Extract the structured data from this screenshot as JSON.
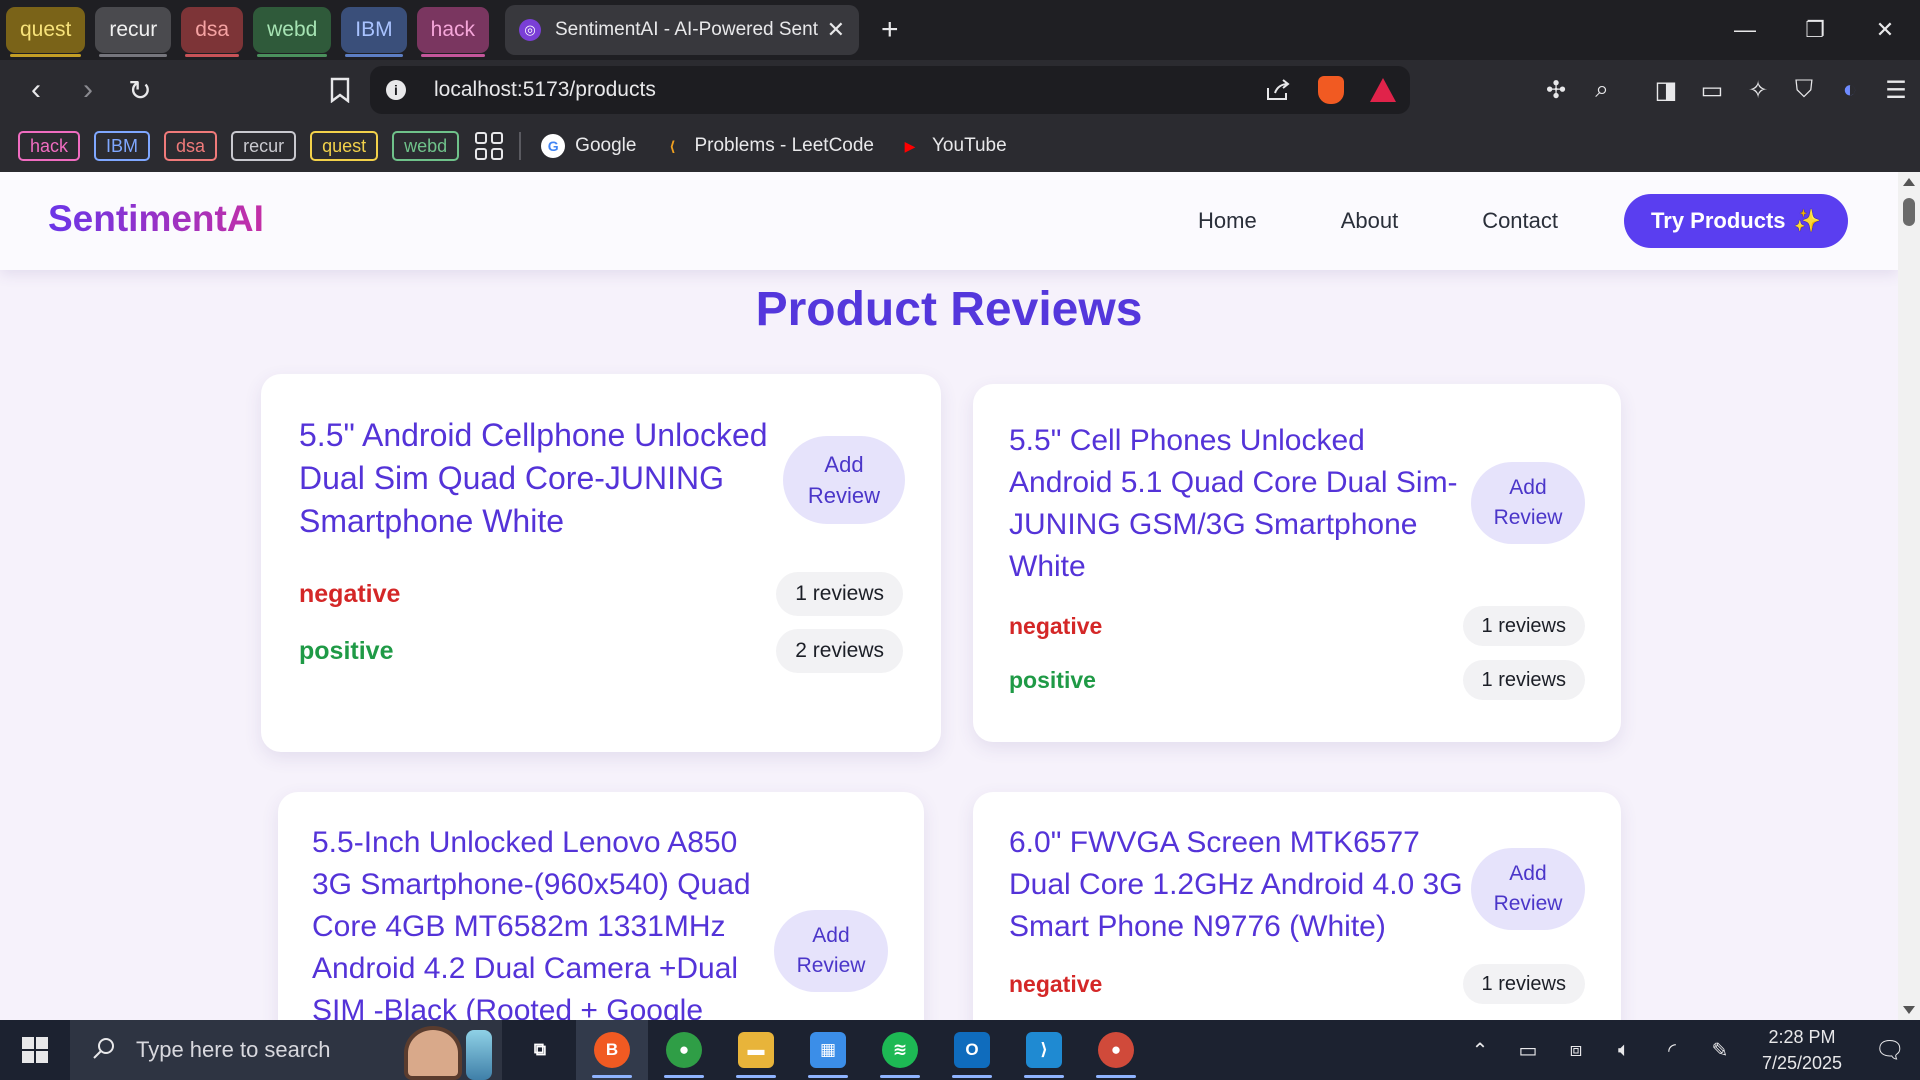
{
  "browser": {
    "tab_groups": [
      {
        "label": "quest",
        "bg": "#7a6318",
        "fg": "#f7e27a"
      },
      {
        "label": "recur",
        "bg": "#4a4a4e",
        "fg": "#f0f0f0"
      },
      {
        "label": "dsa",
        "bg": "#7d3437",
        "fg": "#f5a3a3"
      },
      {
        "label": "webd",
        "bg": "#2f5a3a",
        "fg": "#a6e3b3"
      },
      {
        "label": "IBM",
        "bg": "#3a4f7a",
        "fg": "#a9c3ff"
      },
      {
        "label": "hack",
        "bg": "#7a3660",
        "fg": "#f5a6d9"
      }
    ],
    "active_tab": {
      "title": "SentimentAI - AI-Powered Sentiment",
      "close": "✕"
    },
    "new_tab": "+",
    "window_controls": {
      "minimize": "—",
      "restore": "❐",
      "close": "✕"
    },
    "address": {
      "url": "localhost:5173/products"
    },
    "nav": {
      "back": "‹",
      "forward": "›",
      "reload": "↻"
    },
    "bookmarks_chips": [
      {
        "label": "hack",
        "color": "#f06cc0"
      },
      {
        "label": "IBM",
        "color": "#7fa7ff"
      },
      {
        "label": "dsa",
        "color": "#f07a7a"
      },
      {
        "label": "recur",
        "color": "#c9c9cf"
      },
      {
        "label": "quest",
        "color": "#f2d14a"
      },
      {
        "label": "webd",
        "color": "#6fc28a"
      }
    ],
    "bookmarks_links": [
      {
        "label": "Google",
        "icon": "google-icon",
        "glyph": "G",
        "color": "#4285f4"
      },
      {
        "label": "Problems - LeetCode",
        "icon": "leetcode-icon",
        "glyph": "⟨",
        "color": "#f0a020"
      },
      {
        "label": "YouTube",
        "icon": "youtube-icon",
        "glyph": "▶",
        "color": "#ff0000"
      }
    ]
  },
  "site": {
    "logo": "SentimentAI",
    "nav": [
      "Home",
      "About",
      "Contact"
    ],
    "cta": "Try Products",
    "cta_icon": "✨",
    "page_title": "Product Reviews"
  },
  "products": [
    {
      "title_lines": [
        "5.5\" Android Cellphone Unlocked",
        "Dual Sim Quad Core-JUNING",
        "Smartphone White"
      ],
      "add_lines": [
        "Add",
        "Review"
      ],
      "sentiments": [
        {
          "label": "negative",
          "count": "1 reviews"
        },
        {
          "label": "positive",
          "count": "2 reviews"
        }
      ]
    },
    {
      "title_lines": [
        "5.5\" Cell Phones Unlocked",
        "Android 5.1 Quad Core Dual Sim-",
        "JUNING GSM/3G Smartphone",
        "White"
      ],
      "add_lines": [
        "Add",
        "Review"
      ],
      "sentiments": [
        {
          "label": "negative",
          "count": "1 reviews"
        },
        {
          "label": "positive",
          "count": "1 reviews"
        }
      ]
    },
    {
      "title_lines": [
        "5.5-Inch Unlocked Lenovo A850",
        "3G Smartphone-(960x540) Quad",
        "Core 4GB MT6582m 1331MHz",
        "Android 4.2 Dual Camera +Dual",
        "SIM -Black (Rooted + Google"
      ],
      "add_lines": [
        "Add",
        "Review"
      ],
      "sentiments": []
    },
    {
      "title_lines": [
        "6.0\" FWVGA Screen MTK6577",
        "Dual Core 1.2GHz Android 4.0 3G",
        "Smart Phone N9776 (White)"
      ],
      "add_lines": [
        "Add",
        "Review"
      ],
      "sentiments": [
        {
          "label": "negative",
          "count": "1 reviews"
        }
      ]
    }
  ],
  "taskbar": {
    "search_placeholder": "Type here to search",
    "apps": [
      {
        "name": "task-view-icon",
        "glyph": "⧉",
        "bg": "transparent"
      },
      {
        "name": "brave-taskbar-icon",
        "glyph": "B",
        "bg": "#f15a22",
        "active": true
      },
      {
        "name": "chrome-icon",
        "glyph": "●",
        "bg": "#2f9e46"
      },
      {
        "name": "file-explorer-icon",
        "glyph": "▬",
        "bg": "#e8b43a"
      },
      {
        "name": "microsoft-store-icon",
        "glyph": "▦",
        "bg": "#3b8ee8"
      },
      {
        "name": "spotify-icon",
        "glyph": "≋",
        "bg": "#1db954"
      },
      {
        "name": "outlook-icon",
        "glyph": "O",
        "bg": "#0f6cbd"
      },
      {
        "name": "vscode-icon",
        "glyph": "⟩",
        "bg": "#1f8ad2"
      },
      {
        "name": "chrome-profile-icon",
        "glyph": "●",
        "bg": "#d04a3a"
      }
    ],
    "time": "2:28 PM",
    "date": "7/25/2025"
  }
}
